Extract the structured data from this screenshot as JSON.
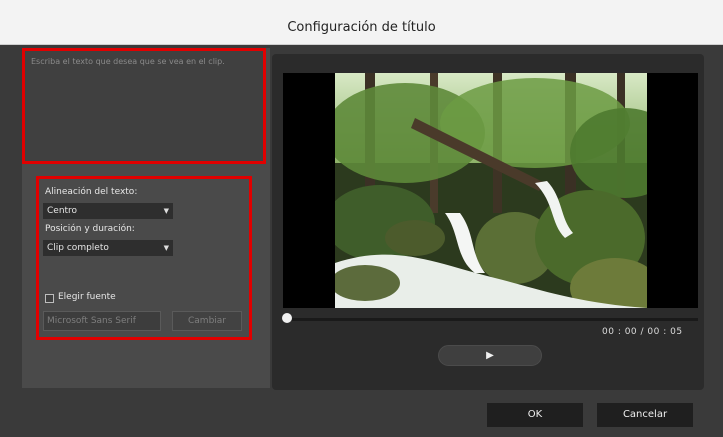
{
  "window": {
    "title": "Configuración de título"
  },
  "text_input": {
    "placeholder": "Escriba el texto que desea que se vea en el clip."
  },
  "options": {
    "alignment_label": "Alineación del texto:",
    "alignment_value": "Centro",
    "position_label": "Posición y duración:",
    "position_value": "Clip completo",
    "choose_font_label": "Elegir fuente",
    "choose_font_checked": false,
    "font_value": "Microsoft Sans Serif",
    "change_button": "Cambiar"
  },
  "preview": {
    "timecode": "00 : 00 / 00 : 05",
    "play_icon": "play-icon",
    "progress": 0
  },
  "footer": {
    "ok": "OK",
    "cancel": "Cancelar"
  },
  "colors": {
    "highlight": "#e10000",
    "background": "#3a3a3a",
    "panel": "#2b2b2b"
  }
}
